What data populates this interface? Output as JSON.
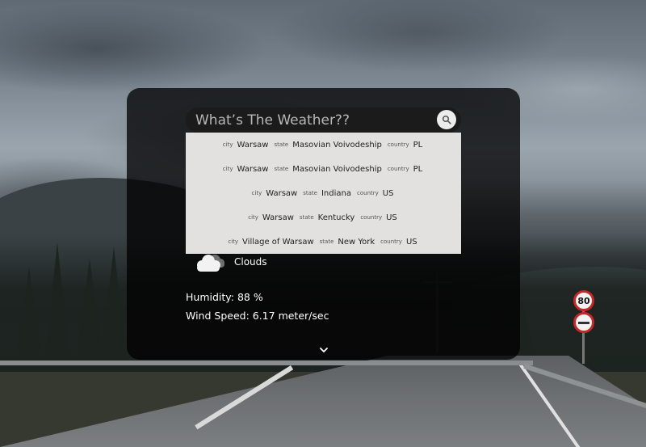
{
  "search": {
    "placeholder": "What’s The Weather??",
    "icon": "search-icon"
  },
  "suggestions": [
    {
      "city_label": "city",
      "city": "Warsaw",
      "state_label": "state",
      "state": "Masovian Voivodeship",
      "country_label": "country",
      "country": "PL"
    },
    {
      "city_label": "city",
      "city": "Warsaw",
      "state_label": "state",
      "state": "Masovian Voivodeship",
      "country_label": "country",
      "country": "PL"
    },
    {
      "city_label": "city",
      "city": "Warsaw",
      "state_label": "state",
      "state": "Indiana",
      "country_label": "country",
      "country": "US"
    },
    {
      "city_label": "city",
      "city": "Warsaw",
      "state_label": "state",
      "state": "Kentucky",
      "country_label": "country",
      "country": "US"
    },
    {
      "city_label": "city",
      "city": "Village of Warsaw",
      "state_label": "state",
      "state": "New York",
      "country_label": "country",
      "country": "US"
    }
  ],
  "weather": {
    "icon": "cloud-icon",
    "condition": "Clouds",
    "humidity": "Humidity: 88 %",
    "wind": "Wind Speed: 6.17 meter/sec"
  },
  "expand_icon": "chevron-down-icon"
}
